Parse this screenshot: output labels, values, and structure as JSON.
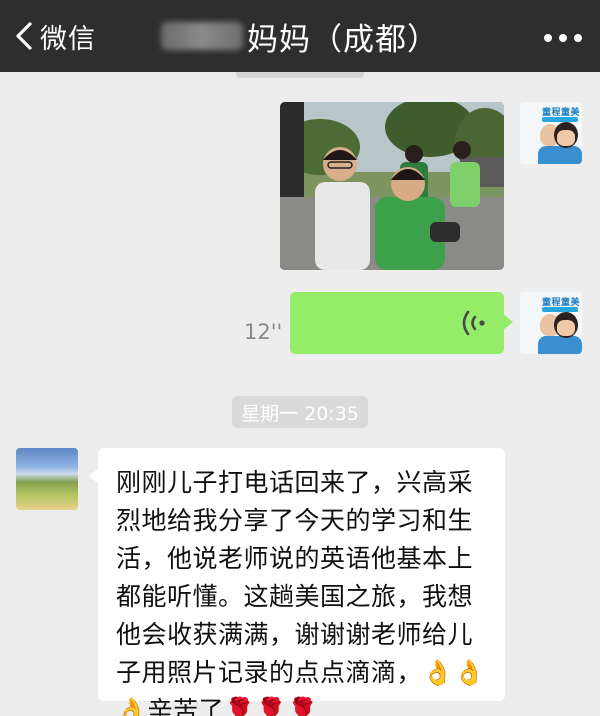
{
  "header": {
    "back_label": "微信",
    "title": "妈妈（成都）",
    "bg_color": "#2e2e2e"
  },
  "messages": {
    "voice": {
      "duration": "12''",
      "bubble_color": "#95ec69"
    },
    "timestamp": "星期一 20:35",
    "text": "刚刚儿子打电话回来了，兴高采烈地给我分享了今天的学习和生活，他说老师说的英语他基本上都能听懂。这趟美国之旅，我想他会收获满满，谢谢谢老师给儿子用照片记录的点点滴滴，👌👌👌辛苦了🌹🌹🌹"
  },
  "self_avatar": {
    "brand": "童程童美"
  },
  "icons": [
    "back-chevron-icon",
    "more-dots-icon",
    "voice-wave-icon"
  ]
}
